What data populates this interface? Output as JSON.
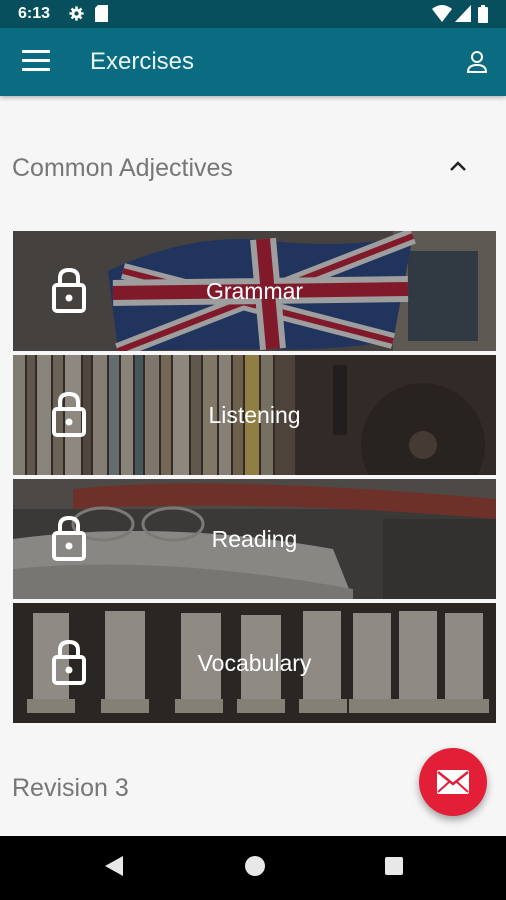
{
  "status_bar": {
    "time": "6:13",
    "icons": [
      "gear-icon",
      "sd-card-icon",
      "wifi-icon",
      "signal-icon",
      "battery-icon"
    ]
  },
  "app_bar": {
    "title": "Exercises",
    "menu_icon": "hamburger-menu-icon",
    "profile_icon": "person-icon"
  },
  "section": {
    "title": "Common Adjectives",
    "expanded_icon": "chevron-up-icon"
  },
  "cards": [
    {
      "label": "Grammar",
      "icon": "lock-icon",
      "background": "union-jack-flag"
    },
    {
      "label": "Listening",
      "icon": "lock-icon",
      "background": "record-shelf"
    },
    {
      "label": "Reading",
      "icon": "lock-icon",
      "background": "books-glasses"
    },
    {
      "label": "Vocabulary",
      "icon": "lock-icon",
      "background": "letter-tiles"
    }
  ],
  "next_section": {
    "title": "Revision 3"
  },
  "fab": {
    "icon": "mail-icon",
    "color": "#e31e37"
  },
  "nav_bar": {
    "buttons": [
      "back-icon",
      "home-icon",
      "recents-icon"
    ]
  },
  "colors": {
    "primary": "#0b6b80",
    "status": "#074f5c",
    "accent": "#e31e37"
  }
}
